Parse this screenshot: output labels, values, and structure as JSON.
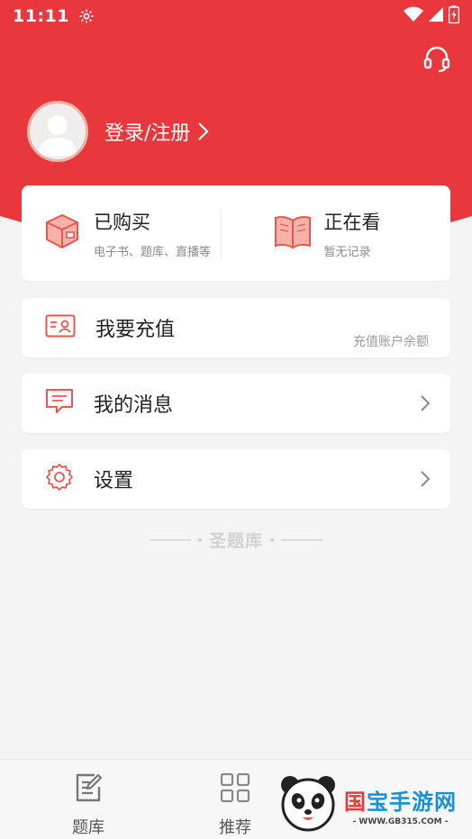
{
  "status_bar": {
    "time": "11:11"
  },
  "header": {
    "login_label": "登录/注册",
    "brand_color": "#e8383d"
  },
  "purchase_card": {
    "purchased": {
      "title": "已购买",
      "subtitle": "电子书、题库、直播等",
      "icon": "package-box-icon"
    },
    "watching": {
      "title": "正在看",
      "subtitle": "暂无记录",
      "icon": "open-book-icon"
    }
  },
  "menu": {
    "recharge": {
      "label": "我要充值",
      "hint": "充值账户余额",
      "icon": "id-card-icon"
    },
    "messages": {
      "label": "我的消息",
      "icon": "message-icon"
    },
    "settings": {
      "label": "设置",
      "icon": "gear-icon"
    }
  },
  "brand_footer": {
    "name": "圣题库"
  },
  "tabbar": {
    "tabs": [
      {
        "label": "题库",
        "icon": "edit-note-icon"
      },
      {
        "label": "推荐",
        "icon": "grid-icon"
      }
    ]
  },
  "watermark": {
    "title_part1": "国",
    "title_part2": "宝手游网",
    "url": "- WWW.GB315.COM -"
  }
}
